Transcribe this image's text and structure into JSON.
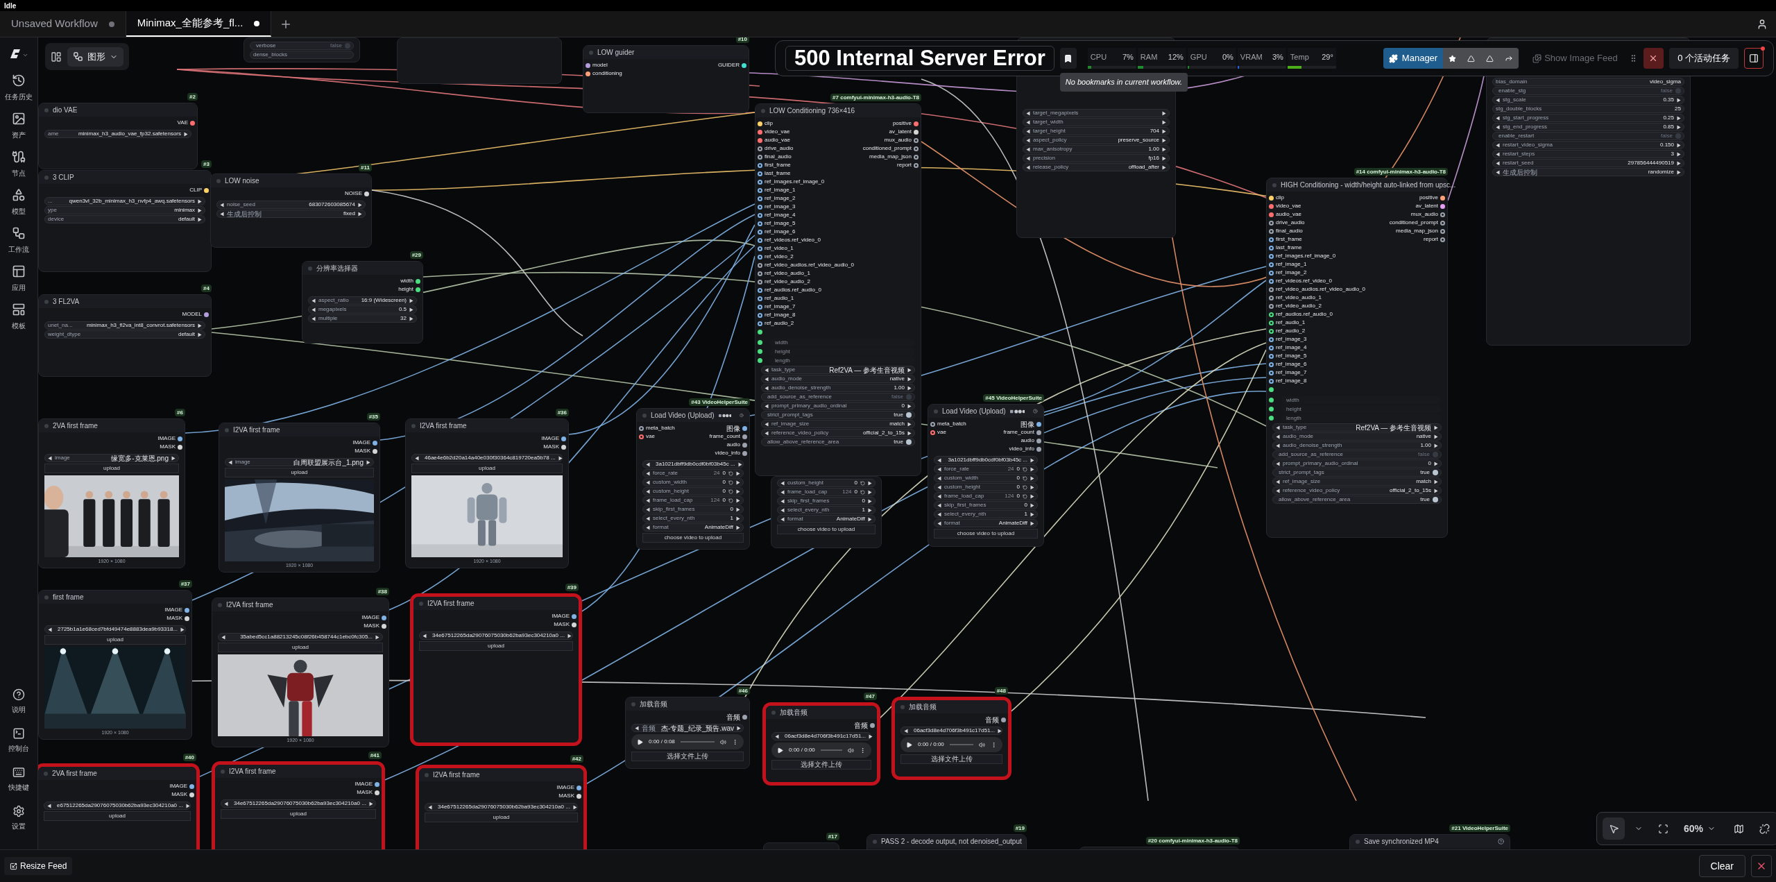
{
  "status": "Idle",
  "tabs": [
    {
      "label": "Unsaved Workflow",
      "selected": false,
      "modified": true
    },
    {
      "label": "Minimax_全能参考_fl...",
      "selected": true,
      "modified": true
    }
  ],
  "sidebar": {
    "items": [
      {
        "label": "任务历史"
      },
      {
        "label": "资产"
      },
      {
        "label": "节点"
      },
      {
        "label": "模型"
      },
      {
        "label": "工作流"
      },
      {
        "label": "应用"
      },
      {
        "label": "模板"
      }
    ],
    "bottom_items": [
      {
        "label": "说明"
      },
      {
        "label": "控制台"
      },
      {
        "label": "快捷键"
      },
      {
        "label": "设置"
      }
    ]
  },
  "canvas_toolbar": {
    "mode": "图形"
  },
  "toolbar": {
    "error": "500 Internal Server Error",
    "bookmark_tooltip": "No bookmarks in current workflow.",
    "metrics": [
      {
        "label": "CPU",
        "value": "7%",
        "level": 0.07
      },
      {
        "label": "RAM",
        "value": "12%",
        "level": 0.12
      },
      {
        "label": "GPU",
        "value": "0%",
        "level": 0
      },
      {
        "label": "VRAM",
        "value": "3%",
        "level": 0.03
      },
      {
        "label": "Temp",
        "value": "29°",
        "level": 0.29
      }
    ],
    "manager": "Manager",
    "image_feed": "Show Image Feed",
    "tasks": "0 个活动任务"
  },
  "nodes": [
    {
      "kind": "node",
      "highlighted": false,
      "widgets": [
        {
          "kind": "toggle",
          "label": "verbose",
          "value": "false",
          "on": false
        },
        {
          "kind": "plain",
          "label": "dense_blocks"
        }
      ]
    },
    {
      "kind": "node",
      "highlighted": false
    },
    {
      "kind": "node",
      "badge": "#10",
      "title": "LOW guider",
      "highlighted": false,
      "inputs": [
        {
          "label": "model",
          "color": "#b39ddb",
          "hollow": false
        },
        {
          "label": "conditioning",
          "color": "#ffa07a",
          "hollow": false
        }
      ],
      "outputs": [
        {
          "label": "GUIDER",
          "color": "#40e0d0",
          "hollow": false
        }
      ]
    },
    {
      "kind": "node",
      "badge": "#2",
      "title": "dio VAE",
      "highlighted": false,
      "outputs": [
        {
          "label": "VAE",
          "color": "#ff6e6e",
          "hollow": false
        }
      ],
      "widgets": [
        {
          "kind": "plain-arrow",
          "label": "ame",
          "value": "minimax_h3_audio_vae_fp32.safetensors"
        }
      ]
    },
    {
      "kind": "node",
      "badge": "#3",
      "title": "3 CLIP",
      "highlighted": false,
      "outputs": [
        {
          "label": "CLIP",
          "color": "#ffd166",
          "hollow": false
        }
      ],
      "widgets": [
        {
          "kind": "plain-arrow",
          "label": "...",
          "value": "qwen3vl_32b_minimax_h3_nvfp4_awq.safetensors"
        },
        {
          "kind": "plain-arrow",
          "label": "ype",
          "value": "minimax"
        },
        {
          "kind": "plain-arrow",
          "label": "device",
          "value": "default"
        }
      ]
    },
    {
      "kind": "node",
      "badge": "#11",
      "title": "LOW noise",
      "highlighted": false,
      "outputs": [
        {
          "label": "NOISE",
          "color": "#d4d4d4",
          "hollow": false
        }
      ],
      "widgets": [
        {
          "kind": "combo",
          "label": "noise_seed",
          "value": "683072603085674"
        },
        {
          "kind": "combo",
          "label": "生成后控制",
          "value": "fixed"
        }
      ]
    },
    {
      "kind": "node",
      "badge": "#29",
      "title": "分辨率选择器",
      "highlighted": false,
      "outputs": [
        {
          "label": "width",
          "color": "#4ade80",
          "hollow": false
        },
        {
          "label": "height",
          "color": "#4ade80",
          "hollow": false
        }
      ],
      "widgets": [
        {
          "kind": "combo",
          "label": "aspect_ratio",
          "value": "16:9 (Widescreen)"
        },
        {
          "kind": "combo",
          "label": "megapixels",
          "value": "0.5"
        },
        {
          "kind": "combo",
          "label": "multiple",
          "value": "32"
        }
      ]
    },
    {
      "kind": "node",
      "badge": "#4",
      "title": "3 FL2VA",
      "highlighted": false,
      "outputs": [
        {
          "label": "MODEL",
          "color": "#b39ddb",
          "hollow": false
        }
      ],
      "widgets": [
        {
          "kind": "plain-arrow",
          "label": "unet_na...",
          "value": "minimax_h3_fl2va_int8_convrot.safetensors"
        },
        {
          "kind": "plain-arrow",
          "label": "weight_dtype",
          "value": "default"
        }
      ]
    },
    {
      "kind": "node",
      "highlighted": false,
      "widgets": [
        {
          "kind": "number",
          "label": "custom_height",
          "value": "0"
        },
        {
          "kind": "number",
          "label": "frame_load_cap",
          "hint": "124",
          "value": "0"
        },
        {
          "kind": "combo",
          "label": "skip_first_frames",
          "value": "0"
        },
        {
          "kind": "combo",
          "label": "select_every_nth",
          "value": "1"
        },
        {
          "kind": "combo",
          "label": "format",
          "value": "AnimateDiff"
        },
        {
          "kind": "button",
          "label": "choose video to upload"
        }
      ]
    },
    {
      "kind": "node",
      "badge": "#7 comfyui-minimax-h3-audio-T8",
      "title": "LOW Conditioning 736×416",
      "highlighted": false,
      "inputs": [
        {
          "label": "clip",
          "color": "#ffd166",
          "hollow": false
        },
        {
          "label": "video_vae",
          "color": "#ff6e6e",
          "hollow": false
        },
        {
          "label": "audio_vae",
          "color": "#ff6e6e",
          "hollow": false
        },
        {
          "label": "drive_audio",
          "color": "#9ca3af",
          "hollow": true
        },
        {
          "label": "final_audio",
          "color": "#9ca3af",
          "hollow": true
        },
        {
          "label": "first_frame",
          "color": "#7fb2e5",
          "hollow": true
        },
        {
          "label": "last_frame",
          "color": "#7fb2e5",
          "hollow": true
        },
        {
          "label": "ref_images.ref_image_0",
          "color": "#7fb2e5",
          "hollow": true
        },
        {
          "label": "ref_image_1",
          "color": "#7fb2e5",
          "hollow": true
        },
        {
          "label": "ref_image_2",
          "color": "#7fb2e5",
          "hollow": true
        },
        {
          "label": "ref_image_3",
          "color": "#7fb2e5",
          "hollow": true
        },
        {
          "label": "ref_image_4",
          "color": "#7fb2e5",
          "hollow": true
        },
        {
          "label": "ref_image_5",
          "color": "#7fb2e5",
          "hollow": true
        },
        {
          "label": "ref_image_6",
          "color": "#7fb2e5",
          "hollow": true
        },
        {
          "label": "ref_videos.ref_video_0",
          "color": "#7fb2e5",
          "hollow": true
        },
        {
          "label": "ref_video_1",
          "color": "#7fb2e5",
          "hollow": true
        },
        {
          "label": "ref_video_2",
          "color": "#7fb2e5",
          "hollow": true
        },
        {
          "label": "ref_video_audios.ref_video_audio_0",
          "color": "#9ca3af",
          "hollow": true
        },
        {
          "label": "ref_video_audio_1",
          "color": "#9ca3af",
          "hollow": true
        },
        {
          "label": "ref_video_audio_2",
          "color": "#9ca3af",
          "hollow": true
        },
        {
          "label": "ref_audios.ref_audio_0",
          "color": "#7fb2e5",
          "hollow": true
        },
        {
          "label": "ref_audio_1",
          "color": "#7fb2e5",
          "hollow": true
        },
        {
          "label": "ref_image_7",
          "color": "#7fb2e5",
          "hollow": true
        },
        {
          "label": "ref_image_8",
          "color": "#7fb2e5",
          "hollow": true
        },
        {
          "label": "ref_audio_2",
          "color": "#7fb2e5",
          "hollow": true
        },
        {
          "color": "#4ade80",
          "hollow": false
        }
      ],
      "outputs": [
        {
          "label": "positive",
          "color": "#ff6e6e",
          "hollow": false
        },
        {
          "label": "av_latent",
          "color": "#d4d4d4",
          "hollow": false
        },
        {
          "label": "mux_audio",
          "color": "#9ca3af",
          "hollow": true
        },
        {
          "label": "conditioned_prompt",
          "color": "#9ca3af",
          "hollow": true
        },
        {
          "label": "media_map_json",
          "color": "#9ca3af",
          "hollow": true
        },
        {
          "label": "report",
          "color": "#9ca3af",
          "hollow": true
        }
      ],
      "widgets": [
        {
          "kind": "slot",
          "label": "width"
        },
        {
          "kind": "slot",
          "label": "height"
        },
        {
          "kind": "slot",
          "label": "length"
        },
        {
          "kind": "combo",
          "label": "task_type",
          "value": "Ref2VA — 参考生音视频"
        },
        {
          "kind": "combo",
          "label": "audio_mode",
          "value": "native"
        },
        {
          "kind": "combo",
          "label": "audio_denoise_strength",
          "value": "1.00"
        },
        {
          "kind": "toggle",
          "label": "add_source_as_reference",
          "value": "false",
          "on": false
        },
        {
          "kind": "combo",
          "label": "prompt_primary_audio_ordinal",
          "value": "0"
        },
        {
          "kind": "toggle",
          "label": "strict_prompt_tags",
          "value": "true",
          "on": true
        },
        {
          "kind": "combo",
          "label": "ref_image_size",
          "value": "match"
        },
        {
          "kind": "combo",
          "label": "reference_video_policy",
          "value": "official_2_to_15s"
        },
        {
          "kind": "toggle",
          "label": "allow_above_reference_area",
          "value": "true",
          "on": true
        }
      ]
    },
    {
      "kind": "video-loader",
      "badge": "#43 VideoHelperSuite",
      "title": "Load Video (Upload)",
      "highlighted": false,
      "inputs": [
        {
          "label": "meta_batch",
          "color": "#9ca3af",
          "hollow": true
        },
        {
          "label": "vae",
          "color": "#ff6e6e",
          "hollow": true
        }
      ],
      "outputs": [
        {
          "label": "图像",
          "color": "#7fb2e5",
          "hollow": false
        },
        {
          "label": "frame_count",
          "color": "#9ca3af",
          "hollow": false
        },
        {
          "label": "audio",
          "color": "#9ca3af",
          "hollow": false
        },
        {
          "label": "video_info",
          "color": "#9ca3af",
          "hollow": false
        }
      ],
      "widgets": [
        {
          "kind": "combo",
          "value": "3a1021dbff9db0cdf0bf03b45c ..."
        },
        {
          "kind": "number",
          "label": "force_rate",
          "hint": "24",
          "value": "0"
        },
        {
          "kind": "number",
          "label": "custom_width",
          "value": "0"
        },
        {
          "kind": "number",
          "label": "custom_height",
          "value": "0"
        },
        {
          "kind": "number",
          "label": "frame_load_cap",
          "hint": "124",
          "value": "0"
        },
        {
          "kind": "combo",
          "label": "skip_first_frames",
          "value": "0"
        },
        {
          "kind": "combo",
          "label": "select_every_nth",
          "value": "1"
        },
        {
          "kind": "combo",
          "label": "format",
          "value": "AnimateDiff"
        },
        {
          "kind": "button",
          "label": "choose video to upload"
        }
      ]
    },
    {
      "kind": "video-loader",
      "badge": "#45 VideoHelperSuite",
      "title": "Load Video (Upload)",
      "highlighted": false,
      "inputs": [
        {
          "label": "meta_batch",
          "color": "#9ca3af",
          "hollow": true
        },
        {
          "label": "vae",
          "color": "#ff6e6e",
          "hollow": true
        }
      ],
      "outputs": [
        {
          "label": "图像",
          "color": "#7fb2e5",
          "hollow": false
        },
        {
          "label": "frame_count",
          "color": "#9ca3af",
          "hollow": false
        },
        {
          "label": "audio",
          "color": "#9ca3af",
          "hollow": false
        },
        {
          "label": "video_info",
          "color": "#9ca3af",
          "hollow": false
        }
      ],
      "widgets": [
        {
          "kind": "combo",
          "value": "3a1021dbff9db0cdf0bf03b45c ..."
        },
        {
          "kind": "number",
          "label": "force_rate",
          "hint": "24",
          "value": "0"
        },
        {
          "kind": "number",
          "label": "custom_width",
          "value": "0"
        },
        {
          "kind": "number",
          "label": "custom_height",
          "value": "0"
        },
        {
          "kind": "number",
          "label": "frame_load_cap",
          "hint": "124",
          "value": "0"
        },
        {
          "kind": "combo",
          "label": "skip_first_frames",
          "value": "0"
        },
        {
          "kind": "combo",
          "label": "select_every_nth",
          "value": "1"
        },
        {
          "kind": "combo",
          "label": "format",
          "value": "AnimateDiff"
        },
        {
          "kind": "button",
          "label": "choose video to upload"
        }
      ]
    },
    {
      "kind": "node",
      "highlighted": false,
      "widgets": [
        {
          "kind": "combo",
          "label": "target_megapixels"
        },
        {
          "kind": "combo",
          "label": "target_width"
        },
        {
          "kind": "combo",
          "label": "target_height",
          "value": "704"
        },
        {
          "kind": "combo",
          "label": "aspect_policy",
          "value": "preserve_source"
        },
        {
          "kind": "combo",
          "label": "max_anisotropy",
          "value": "1.00"
        },
        {
          "kind": "combo",
          "label": "precision",
          "value": "fp16"
        },
        {
          "kind": "combo",
          "label": "release_policy",
          "value": "offload_after"
        }
      ]
    },
    {
      "kind": "node",
      "highlighted": false,
      "widgets": [
        {
          "kind": "plain",
          "label": "bias_domain",
          "value": "video_sigma"
        },
        {
          "kind": "toggle",
          "label": "enable_stg",
          "value": "false",
          "on": false
        },
        {
          "kind": "combo",
          "label": "stg_scale",
          "value": "0.35"
        },
        {
          "kind": "plain",
          "label": "stg_double_blocks",
          "value": "25"
        },
        {
          "kind": "combo",
          "label": "stg_start_progress",
          "value": "0.25"
        },
        {
          "kind": "combo",
          "label": "stg_end_progress",
          "value": "0.85"
        },
        {
          "kind": "toggle",
          "label": "enable_restart",
          "value": "false",
          "on": false
        },
        {
          "kind": "combo",
          "label": "restart_video_sigma",
          "value": "0.150"
        },
        {
          "kind": "combo",
          "label": "restart_steps",
          "value": "3"
        },
        {
          "kind": "combo",
          "label": "restart_seed",
          "value": "297856444490519"
        },
        {
          "kind": "combo",
          "label": "生成后控制",
          "value": "randomize"
        }
      ]
    },
    {
      "kind": "node",
      "badge": "#14 comfyui-minimax-h3-audio-T8",
      "title": "HIGH Conditioning - width/height auto-linked from upsc...",
      "highlighted": false,
      "inputs": [
        {
          "label": "clip",
          "color": "#ffd166",
          "hollow": false
        },
        {
          "label": "video_vae",
          "color": "#ff6e6e",
          "hollow": false
        },
        {
          "label": "audio_vae",
          "color": "#ff6e6e",
          "hollow": false
        },
        {
          "label": "drive_audio",
          "color": "#9ca3af",
          "hollow": true
        },
        {
          "label": "final_audio",
          "color": "#9ca3af",
          "hollow": true
        },
        {
          "label": "first_frame",
          "color": "#7fb2e5",
          "hollow": true
        },
        {
          "label": "last_frame",
          "color": "#7fb2e5",
          "hollow": true
        },
        {
          "label": "ref_images.ref_image_0",
          "color": "#7fb2e5",
          "hollow": true
        },
        {
          "label": "ref_image_1",
          "color": "#7fb2e5",
          "hollow": true
        },
        {
          "label": "ref_image_2",
          "color": "#7fb2e5",
          "hollow": true
        },
        {
          "label": "ref_videos.ref_video_0",
          "color": "#7fb2e5",
          "hollow": true
        },
        {
          "label": "ref_video_audios.ref_video_audio_0",
          "color": "#9ca3af",
          "hollow": true
        },
        {
          "label": "ref_video_audio_1",
          "color": "#9ca3af",
          "hollow": true
        },
        {
          "label": "ref_video_audio_2",
          "color": "#9ca3af",
          "hollow": true
        },
        {
          "label": "ref_audios.ref_audio_0",
          "color": "#4ade80",
          "hollow": true
        },
        {
          "label": "ref_audio_1",
          "color": "#4ade80",
          "hollow": true
        },
        {
          "label": "ref_audio_2",
          "color": "#4ade80",
          "hollow": true
        },
        {
          "label": "ref_image_3",
          "color": "#7fb2e5",
          "hollow": true
        },
        {
          "label": "ref_image_4",
          "color": "#7fb2e5",
          "hollow": true
        },
        {
          "label": "ref_image_5",
          "color": "#7fb2e5",
          "hollow": true
        },
        {
          "label": "ref_image_6",
          "color": "#7fb2e5",
          "hollow": true
        },
        {
          "label": "ref_image_7",
          "color": "#7fb2e5",
          "hollow": true
        },
        {
          "label": "ref_image_8",
          "color": "#7fb2e5",
          "hollow": true
        },
        {
          "color": "#4ade80",
          "hollow": false
        }
      ],
      "outputs": [
        {
          "label": "positive",
          "color": "#ffa07a",
          "hollow": false
        },
        {
          "label": "av_latent",
          "color": "#e79ff5",
          "hollow": false
        },
        {
          "label": "mux_audio",
          "color": "#9ca3af",
          "hollow": true
        },
        {
          "label": "conditioned_prompt",
          "color": "#9ca3af",
          "hollow": true
        },
        {
          "label": "media_map_json",
          "color": "#9ca3af",
          "hollow": true
        },
        {
          "label": "report",
          "color": "#9ca3af",
          "hollow": true
        }
      ],
      "widgets": [
        {
          "kind": "slot",
          "label": "width"
        },
        {
          "kind": "slot",
          "label": "height"
        },
        {
          "kind": "slot",
          "label": "length"
        },
        {
          "kind": "combo",
          "label": "task_type",
          "value": "Ref2VA — 参考生音视频"
        },
        {
          "kind": "combo",
          "label": "audio_mode",
          "value": "native"
        },
        {
          "kind": "combo",
          "label": "audio_denoise_strength",
          "value": "1.00"
        },
        {
          "kind": "toggle",
          "label": "add_source_as_reference",
          "value": "false",
          "on": false
        },
        {
          "kind": "combo",
          "label": "prompt_primary_audio_ordinal",
          "value": "0"
        },
        {
          "kind": "toggle",
          "label": "strict_prompt_tags",
          "value": "true",
          "on": true
        },
        {
          "kind": "combo",
          "label": "ref_image_size",
          "value": "match"
        },
        {
          "kind": "combo",
          "label": "reference_video_policy",
          "value": "official_2_to_15s"
        },
        {
          "kind": "toggle",
          "label": "allow_above_reference_area",
          "value": "true",
          "on": true
        }
      ]
    },
    {
      "kind": "node",
      "badge": "#6",
      "title": "2VA first frame",
      "highlighted": false,
      "outputs": [
        {
          "label": "IMAGE",
          "color": "#7fb2e5",
          "hollow": false
        },
        {
          "label": "MASK",
          "color": "#d4d4d4",
          "hollow": false
        }
      ],
      "widgets": [
        {
          "kind": "combo",
          "label": "image",
          "value": "缘宽多-克莱恩.png"
        },
        {
          "kind": "button",
          "label": "upload"
        },
        {
          "kind": "preview",
          "size": "1920 × 1080"
        }
      ]
    },
    {
      "kind": "node",
      "badge": "#35",
      "title": "I2VA first frame",
      "highlighted": false,
      "outputs": [
        {
          "label": "IMAGE",
          "color": "#7fb2e5",
          "hollow": false
        },
        {
          "label": "MASK",
          "color": "#d4d4d4",
          "hollow": false
        }
      ],
      "widgets": [
        {
          "kind": "combo",
          "label": "image",
          "value": "白周联盟展示台_1.png"
        },
        {
          "kind": "button",
          "label": "upload"
        },
        {
          "kind": "preview",
          "size": "1920 × 1080"
        }
      ]
    },
    {
      "kind": "node",
      "badge": "#36",
      "title": "I2VA first frame",
      "highlighted": false,
      "outputs": [
        {
          "label": "IMAGE",
          "color": "#7fb2e5",
          "hollow": false
        },
        {
          "label": "MASK",
          "color": "#d4d4d4",
          "hollow": false
        }
      ],
      "widgets": [
        {
          "kind": "combo",
          "value": "46ae4e6b2d20a14a40e030f30364c819720ea5b78 ..."
        },
        {
          "kind": "button",
          "label": "upload"
        },
        {
          "kind": "preview",
          "size": "1920 × 1080"
        }
      ]
    },
    {
      "kind": "node",
      "badge": "#37",
      "title": "first frame",
      "highlighted": false,
      "outputs": [
        {
          "label": "IMAGE",
          "color": "#7fb2e5",
          "hollow": false
        },
        {
          "label": "MASK",
          "color": "#d4d4d4",
          "hollow": false
        }
      ],
      "widgets": [
        {
          "kind": "combo",
          "value": "2725b1a1e68ced7bfd49474e8883dea9b93318..."
        },
        {
          "kind": "button",
          "label": "upload"
        },
        {
          "kind": "preview",
          "size": "1920 × 1080"
        }
      ]
    },
    {
      "kind": "node",
      "badge": "#38",
      "title": "I2VA first frame",
      "highlighted": false,
      "outputs": [
        {
          "label": "IMAGE",
          "color": "#7fb2e5",
          "hollow": false
        },
        {
          "label": "MASK",
          "color": "#d4d4d4",
          "hollow": false
        }
      ],
      "widgets": [
        {
          "kind": "combo",
          "value": "35abed5cc1a88213245c08f26b458744c1ebc0fc305..."
        },
        {
          "kind": "button",
          "label": "upload"
        },
        {
          "kind": "preview",
          "size": "1920 × 1080"
        }
      ]
    },
    {
      "kind": "node",
      "badge": "#39",
      "title": "I2VA first frame",
      "highlighted": true,
      "outputs": [
        {
          "label": "IMAGE",
          "color": "#7fb2e5",
          "hollow": false
        },
        {
          "label": "MASK",
          "color": "#d4d4d4",
          "hollow": false
        }
      ],
      "widgets": [
        {
          "kind": "combo",
          "value": "34e67512265da29076075030b62ba93ec304210a0 ..."
        },
        {
          "kind": "button",
          "label": "upload"
        }
      ]
    },
    {
      "kind": "node",
      "badge": "#40",
      "title": "2VA first frame",
      "highlighted": true,
      "outputs": [
        {
          "label": "IMAGE",
          "color": "#7fb2e5",
          "hollow": false
        },
        {
          "label": "MASK",
          "color": "#d4d4d4",
          "hollow": false
        }
      ],
      "widgets": [
        {
          "kind": "combo",
          "value": "e67512265da29076075030b62ba93ec304210a0 ..."
        },
        {
          "kind": "button",
          "label": "upload"
        }
      ]
    },
    {
      "kind": "node",
      "badge": "#41",
      "title": "I2VA first frame",
      "highlighted": true,
      "outputs": [
        {
          "label": "IMAGE",
          "color": "#7fb2e5",
          "hollow": false
        },
        {
          "label": "MASK",
          "color": "#d4d4d4",
          "hollow": false
        }
      ],
      "widgets": [
        {
          "kind": "combo",
          "value": "34e67512265da29076075030b62ba93ec304210a0 ..."
        },
        {
          "kind": "button",
          "label": "upload"
        }
      ]
    },
    {
      "kind": "node",
      "badge": "#42",
      "title": "I2VA first frame",
      "highlighted": true,
      "outputs": [
        {
          "label": "IMAGE",
          "color": "#7fb2e5",
          "hollow": false
        },
        {
          "label": "MASK",
          "color": "#d4d4d4",
          "hollow": false
        }
      ],
      "widgets": [
        {
          "kind": "combo",
          "value": "34e67512265da29076075030b62ba93ec304210a0 ..."
        },
        {
          "kind": "button",
          "label": "upload"
        }
      ]
    },
    {
      "kind": "node",
      "badge": "#46",
      "title": "加载音频",
      "highlighted": false,
      "outputs": [
        {
          "label": "音频",
          "color": "#9ca3af",
          "hollow": false
        }
      ],
      "widgets": [
        {
          "kind": "combo",
          "label": "音频",
          "value": "杰-专题_纪录_预告.wav"
        },
        {
          "kind": "audio",
          "time": "0:00 / 0:08"
        },
        {
          "kind": "button",
          "label": "选择文件上传"
        }
      ]
    },
    {
      "kind": "node",
      "badge": "#47",
      "title": "加载音频",
      "highlighted": true,
      "outputs": [
        {
          "label": "音频",
          "color": "#9ca3af",
          "hollow": false
        }
      ],
      "widgets": [
        {
          "kind": "combo",
          "value": "06acf3d8e4d706f3b491c17d51..."
        },
        {
          "kind": "audio",
          "time": "0:00 / 0:00"
        },
        {
          "kind": "button",
          "label": "选择文件上传"
        }
      ]
    },
    {
      "kind": "node",
      "badge": "#48",
      "title": "加载音频",
      "highlighted": true,
      "outputs": [
        {
          "label": "音频",
          "color": "#9ca3af",
          "hollow": false
        }
      ],
      "widgets": [
        {
          "kind": "combo",
          "value": "06acf3d8e4d706f3b491c17d51..."
        },
        {
          "kind": "audio",
          "time": "0:00 / 0:00"
        },
        {
          "kind": "button",
          "label": "选择文件上传"
        }
      ]
    },
    {
      "kind": "node",
      "badge": "#17",
      "highlighted": false
    },
    {
      "kind": "node",
      "badge": "#19",
      "title": "PASS 2 - decode output, not denoised_output",
      "highlighted": false
    },
    {
      "kind": "node",
      "badge": "#20 comfyui-minimax-h3-audio-T8",
      "highlighted": false
    },
    {
      "kind": "helper",
      "badge": "#21 VideoHelperSuite",
      "title": "Save synchronized MP4",
      "highlighted": false
    }
  ],
  "zoom": "60%",
  "feed": {
    "resize": "Resize Feed",
    "clear": "Clear"
  }
}
